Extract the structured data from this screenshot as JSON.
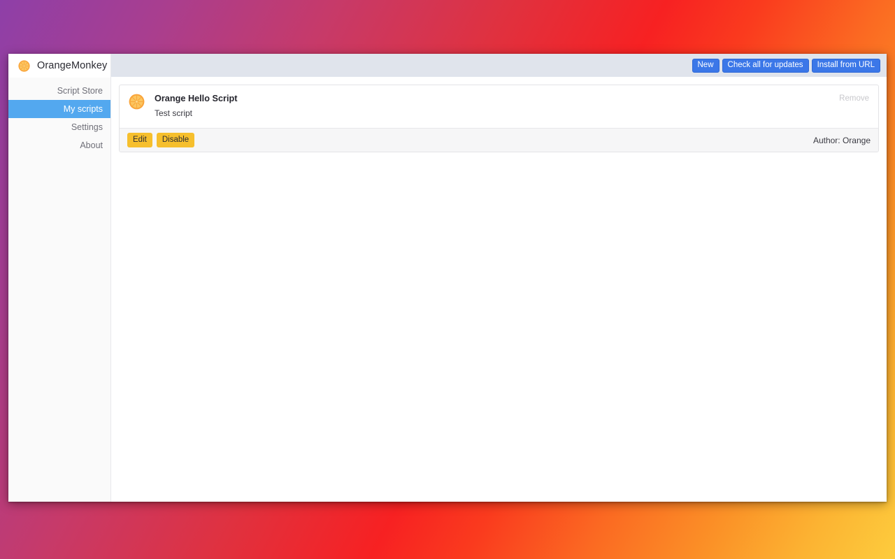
{
  "app": {
    "brand_name": "OrangeMonkey",
    "logo_icon": "orange-slice-icon",
    "accent_blue": "#3b77e8",
    "accent_yellow": "#f6bf2d",
    "active_nav_color": "#53a8ef",
    "toolbar_bg": "#e0e4ec"
  },
  "sidebar": {
    "items": [
      {
        "label": "Script Store",
        "active": false
      },
      {
        "label": "My scripts",
        "active": true
      },
      {
        "label": "Settings",
        "active": false
      },
      {
        "label": "About",
        "active": false
      }
    ]
  },
  "toolbar": {
    "buttons": [
      {
        "label": "New"
      },
      {
        "label": "Check all for updates"
      },
      {
        "label": "Install from URL"
      }
    ]
  },
  "scripts": [
    {
      "icon": "orange-slice-icon",
      "title": "Orange Hello Script",
      "description": "Test script",
      "remove_label": "Remove",
      "actions": [
        {
          "label": "Edit"
        },
        {
          "label": "Disable"
        }
      ],
      "author": "Author: Orange"
    }
  ]
}
